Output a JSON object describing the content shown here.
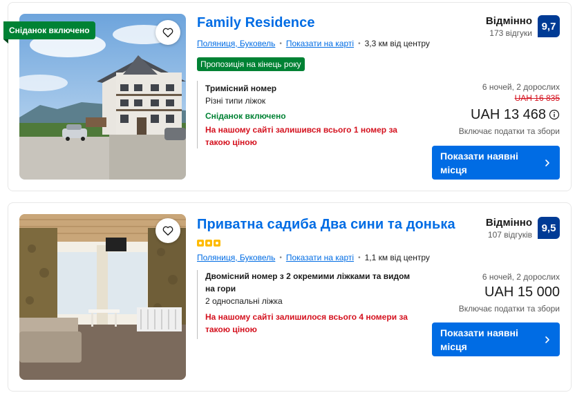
{
  "listings": [
    {
      "title": "Family Residence",
      "ribbon": "Сніданок включено",
      "location": "Поляниця, Буковель",
      "map_link": "Показати на карті",
      "distance": "3,3 км від центру",
      "deal_badge": "Пропозиція на кінець року",
      "room_name": "Тримісний номер",
      "beds": "Різні типи ліжок",
      "breakfast": "Сніданок включено",
      "scarcity": "На нашому сайті залишився всього 1 номер за такою ціною",
      "rating_word": "Відмінно",
      "reviews": "173 відгуки",
      "score": "9,7",
      "stay": "6 ночей, 2 дорослих",
      "old_price": "UAH 16 835",
      "price": "UAH 13 468",
      "taxes": "Включає податки та збори",
      "cta": "Показати наявні місця",
      "icons": {
        "favorite": "heart-icon",
        "info": "info-icon",
        "cta": "chevron-right-icon"
      }
    },
    {
      "title": "Приватна садиба Два сини та донька",
      "star_count": 3,
      "location": "Поляниця, Буковель",
      "map_link": "Показати на карті",
      "distance": "1,1 км від центру",
      "room_name": "Двомісний номер з 2 окремими ліжками та видом на гори",
      "beds": "2 односпальні ліжка",
      "scarcity": "На нашому сайті залишилося всього 4 номери за такою ціною",
      "rating_word": "Відмінно",
      "reviews": "107 відгуків",
      "score": "9,5",
      "stay": "6 ночей, 2 дорослих",
      "price": "UAH 15 000",
      "taxes": "Включає податки та збори",
      "cta": "Показати наявні місця",
      "icons": {
        "favorite": "heart-icon",
        "cta": "chevron-right-icon"
      }
    }
  ],
  "colors": {
    "link": "#006ce4",
    "green": "#008234",
    "red": "#d4111e",
    "score_bg": "#003b95",
    "star": "#febb02"
  }
}
